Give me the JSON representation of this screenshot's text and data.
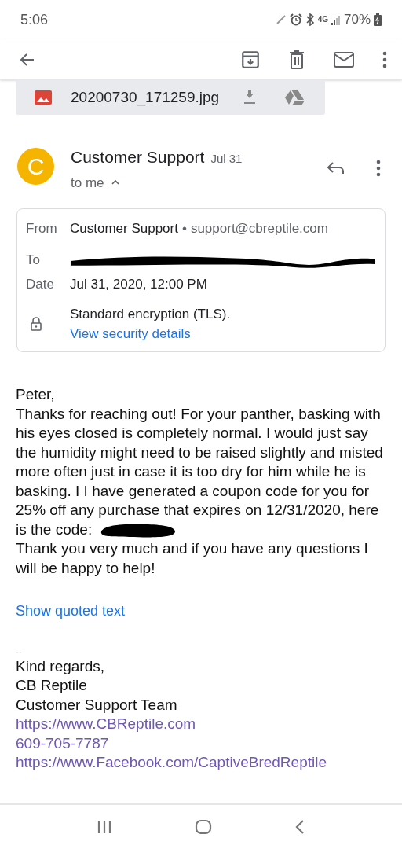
{
  "status_bar": {
    "time": "5:06",
    "network": "4G",
    "battery": "70%"
  },
  "attachment": {
    "filename": "20200730_171259.jpg"
  },
  "header": {
    "avatar_letter": "C",
    "sender": "Customer Support",
    "date": "Jul 31",
    "recipients": "to me",
    "expanded": true
  },
  "details": {
    "from_label": "From",
    "from_name": "Customer Support",
    "separator": "•",
    "from_email": "support@cbreptile.com",
    "to_label": "To",
    "date_label": "Date",
    "date": "Jul 31, 2020, 12:00 PM",
    "encryption": "Standard encryption (TLS).",
    "security_link": "View security details"
  },
  "body": {
    "greeting": "Peter,",
    "paragraphs": [
      "Thanks for reaching out! For your panther, basking with his eyes closed is completely normal. I would just say the humidity might need to be raised slightly and misted more often just in case it is too dry for him while he is basking. I I have generated a coupon code for you for 25% off any purchase that expires on 12/31/2020, here is the code:",
      "Thank you very much and if you have any questions I will be happy to help!"
    ],
    "quoted_link": "Show quoted text"
  },
  "signature": {
    "separator": "--",
    "lines": [
      "Kind regards,",
      "CB Reptile",
      "Customer Support Team"
    ],
    "links": [
      "https://www.CBReptile.com",
      "609-705-7787",
      "https://www.Facebook.com/CaptiveBredReptile"
    ]
  }
}
